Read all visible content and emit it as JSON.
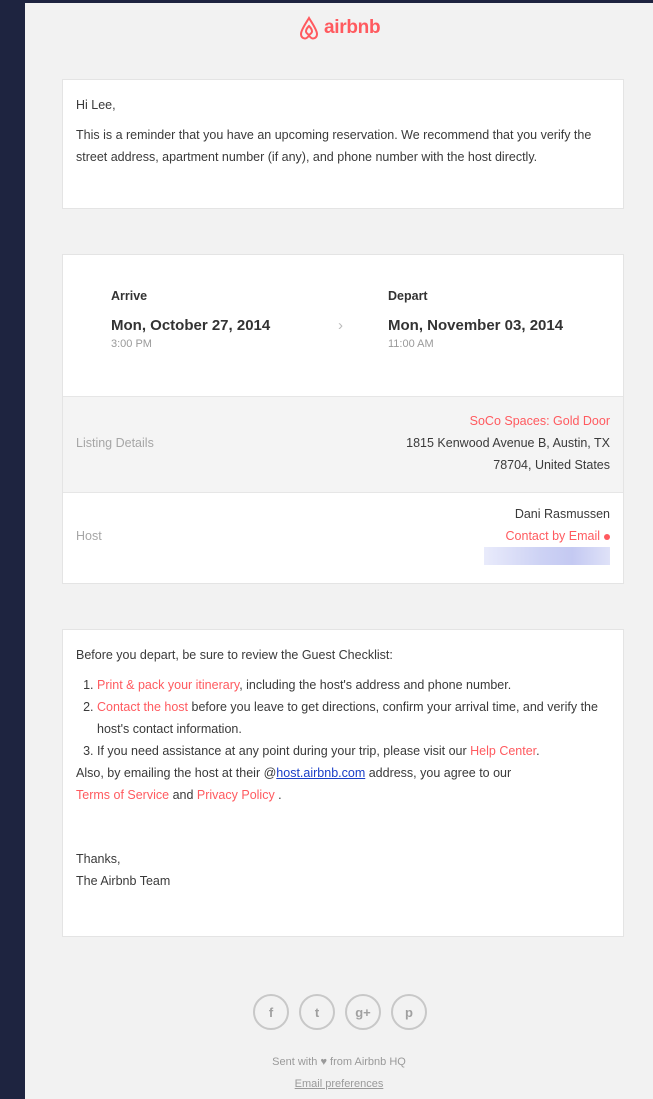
{
  "brand": {
    "name": "airbnb",
    "color": "#ff5a5f"
  },
  "intro": {
    "greeting": "Hi Lee,",
    "message": "This is a reminder that you have an upcoming reservation. We recommend that you verify the street address, apartment number (if any), and phone number with the host directly."
  },
  "reservation": {
    "arrive": {
      "label": "Arrive",
      "date": "Mon, October 27, 2014",
      "time": "3:00 PM"
    },
    "depart": {
      "label": "Depart",
      "date": "Mon, November 03, 2014",
      "time": "11:00 AM"
    },
    "listing": {
      "label": "Listing Details",
      "name": "SoCo Spaces: Gold Door",
      "address_line1": "1815 Kenwood Avenue B, Austin, TX",
      "address_line2": "78704, United States"
    },
    "host": {
      "label": "Host",
      "name": "Dani Rasmussen",
      "contact_link": "Contact by Email"
    }
  },
  "checklist": {
    "intro": "Before you depart, be sure to review the Guest Checklist:",
    "item1_link": "Print & pack your itinerary",
    "item1_text": ", including the host's address and phone number.",
    "item2_link": "Contact the host",
    "item2_text": " before you leave to get directions, confirm your arrival time, and verify the host's contact information.",
    "item3_text": "If you need assistance at any point during your trip, please visit our ",
    "item3_link": "Help Center",
    "item3_end": ".",
    "also_text1": "Also, by emailing the host at their @",
    "also_link": "host.airbnb.com",
    "also_text2": " address, you agree to our",
    "terms_link": "Terms of Service",
    "and_text": " and ",
    "privacy_link": "Privacy Policy",
    "end_text": " .",
    "thanks": "Thanks,",
    "signature": "The Airbnb Team"
  },
  "social": [
    {
      "icon": "facebook-icon",
      "glyph": "f"
    },
    {
      "icon": "twitter-icon",
      "glyph": "t"
    },
    {
      "icon": "google-plus-icon",
      "glyph": "g+"
    },
    {
      "icon": "pinterest-icon",
      "glyph": "p"
    }
  ],
  "footer": {
    "sent_with": "Sent with ♥ from Airbnb HQ",
    "email_prefs": "Email preferences"
  }
}
